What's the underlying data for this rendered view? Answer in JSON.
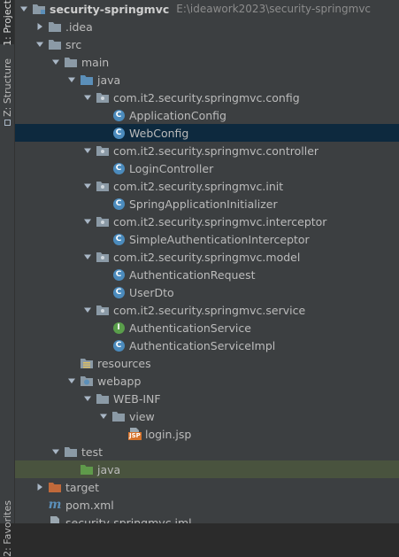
{
  "sidebar": {
    "project_tab": "1: Project",
    "structure_tab": "Z: Structure",
    "favorites_tab": "2: Favorites"
  },
  "tree": {
    "rows": [
      {
        "label": "security-springmvc",
        "path": "E:\\ideawork2023\\security-springmvc",
        "icon": "module-folder-icon",
        "expanded": true
      },
      {
        "label": ".idea",
        "icon": "folder-icon",
        "expanded": false
      },
      {
        "label": "src",
        "icon": "folder-icon",
        "expanded": true
      },
      {
        "label": "main",
        "icon": "folder-icon",
        "expanded": true
      },
      {
        "label": "java",
        "icon": "source-root-icon",
        "expanded": true
      },
      {
        "label": "com.it2.security.springmvc.config",
        "icon": "package-icon",
        "expanded": true
      },
      {
        "label": "ApplicationConfig",
        "icon": "class-icon"
      },
      {
        "label": "WebConfig",
        "icon": "class-icon",
        "selected": true
      },
      {
        "label": "com.it2.security.springmvc.controller",
        "icon": "package-icon",
        "expanded": true
      },
      {
        "label": "LoginController",
        "icon": "class-icon"
      },
      {
        "label": "com.it2.security.springmvc.init",
        "icon": "package-icon",
        "expanded": true
      },
      {
        "label": "SpringApplicationInitializer",
        "icon": "class-icon"
      },
      {
        "label": "com.it2.security.springmvc.interceptor",
        "icon": "package-icon",
        "expanded": true
      },
      {
        "label": "SimpleAuthenticationInterceptor",
        "icon": "class-icon"
      },
      {
        "label": "com.it2.security.springmvc.model",
        "icon": "package-icon",
        "expanded": true
      },
      {
        "label": "AuthenticationRequest",
        "icon": "class-icon"
      },
      {
        "label": "UserDto",
        "icon": "class-icon"
      },
      {
        "label": "com.it2.security.springmvc.service",
        "icon": "package-icon",
        "expanded": true
      },
      {
        "label": "AuthenticationService",
        "icon": "interface-icon"
      },
      {
        "label": "AuthenticationServiceImpl",
        "icon": "class-icon"
      },
      {
        "label": "resources",
        "icon": "resources-folder-icon"
      },
      {
        "label": "webapp",
        "icon": "web-folder-icon",
        "expanded": true
      },
      {
        "label": "WEB-INF",
        "icon": "folder-icon",
        "expanded": true
      },
      {
        "label": "view",
        "icon": "folder-icon",
        "expanded": true
      },
      {
        "label": "login.jsp",
        "icon": "jsp-file-icon"
      },
      {
        "label": "test",
        "icon": "folder-icon",
        "expanded": true
      },
      {
        "label": "java",
        "icon": "test-source-root-icon"
      },
      {
        "label": "target",
        "icon": "excluded-folder-icon",
        "expanded": false
      },
      {
        "label": "pom.xml",
        "icon": "maven-icon"
      },
      {
        "label": "security-springmvc.iml",
        "icon": "iml-file-icon"
      }
    ]
  },
  "colors": {
    "panel_bg": "#3c3f41",
    "selected_bg": "#0d293e",
    "test_root_bg": "#49533e",
    "folder": "#8b9aa6",
    "source_root": "#5b8fb9",
    "test_root": "#5f9a4a",
    "excluded": "#c0693a",
    "class": "#4b8bbd",
    "interface": "#5a9e4b"
  }
}
